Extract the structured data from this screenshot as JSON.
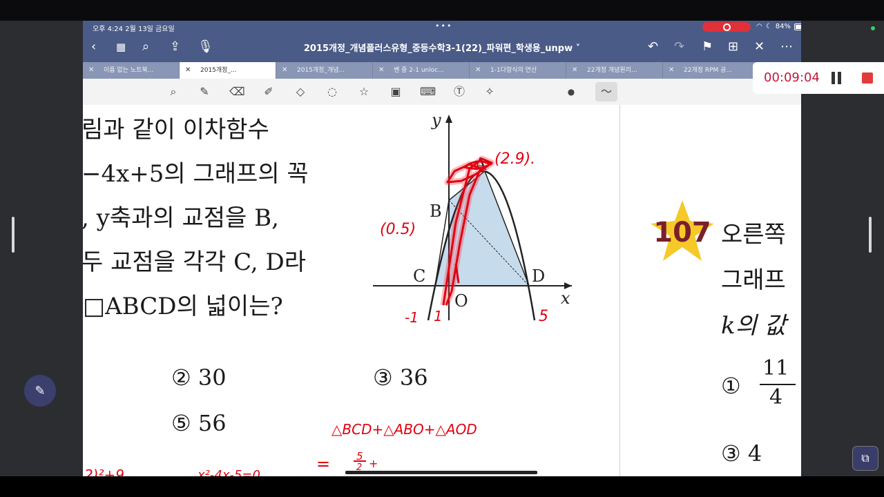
{
  "status": {
    "time_date": "오후 4:24   2월 13일 금요일",
    "battery": "84%",
    "dots": "•••"
  },
  "nav": {
    "title": "2015개정_개념플러스유형_중등수학3-1(22)_파워편_학생용_unpw ˅"
  },
  "tabs": [
    {
      "label": "이름 없는 노트북..."
    },
    {
      "label": "2015개정_..."
    },
    {
      "label": "2015개정_개념..."
    },
    {
      "label": "쎈 중 2-1 unloc..."
    },
    {
      "label": "1-1다항식의 연산"
    },
    {
      "label": "22개정 개념원리..."
    },
    {
      "label": "22개정 RPM 공..."
    }
  ],
  "question": {
    "line1": "림과 같이 이차함수",
    "line2": "−4x+5의 그래프의 꼭",
    "line3": ", y축과의 교점을 B,",
    "line4": "두 교점을 각각 C, D라",
    "line5": "□ABCD의 넓이는?"
  },
  "choices": {
    "c2": "② 30",
    "c3": "③ 36",
    "c5": "⑤ 56"
  },
  "graph_labels": {
    "y": "y",
    "x": "x",
    "A": "A",
    "B": "B",
    "C": "C",
    "D": "D",
    "O": "O"
  },
  "handwriting": {
    "a_coord": "(2.9).",
    "b_coord": "(0.5)",
    "c_tick": "-1",
    "one": "1",
    "d_tick": "5",
    "area_eq": "△BCD+△ABO+△AOD",
    "equals": "=",
    "frac_top": "5",
    "frac_bottom": "2",
    "plus": "+",
    "left_frag": "2)²+9",
    "quad_eq": "x²-4x-5=0"
  },
  "next_problem": {
    "number": "107",
    "line1": "오른쪽 ",
    "line2": "그래프",
    "line3": "k의 값",
    "c1_label": "①",
    "c1_num": "11",
    "c1_den": "4",
    "c3": "③ 4"
  },
  "timer": {
    "value": "00:09:04"
  },
  "colors": {
    "nav": "#4a5b87",
    "ink": "#e10010",
    "badge_star": "#f6c928",
    "badge_text": "#7a1f2b",
    "fill": "#c6dced"
  }
}
